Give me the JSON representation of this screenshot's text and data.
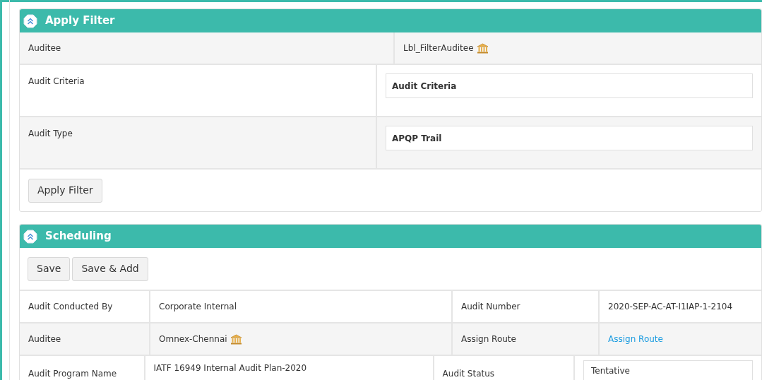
{
  "filter_panel": {
    "title": "Apply Filter",
    "rows": [
      {
        "label": "Auditee",
        "kind": "text_icon",
        "value": "Lbl_FilterAuditee"
      },
      {
        "label": "Audit Criteria",
        "kind": "field",
        "value": "Audit Criteria"
      },
      {
        "label": "Audit Type",
        "kind": "field",
        "value": "APQP Trail"
      }
    ],
    "button": "Apply Filter"
  },
  "scheduling_panel": {
    "title": "Scheduling",
    "buttons": [
      "Save",
      "Save & Add"
    ],
    "rows": [
      {
        "cells": [
          {
            "kind": "label",
            "text": "Audit Conducted By"
          },
          {
            "kind": "text",
            "text": "Corporate Internal"
          },
          {
            "kind": "label",
            "text": "Audit Number"
          },
          {
            "kind": "text",
            "text": "2020-SEP-AC-AT-I1IAP-1-2104"
          }
        ]
      },
      {
        "cells": [
          {
            "kind": "label",
            "text": "Auditee"
          },
          {
            "kind": "text_icon",
            "text": "Omnex-Chennai"
          },
          {
            "kind": "label",
            "text": "Assign Route"
          },
          {
            "kind": "link",
            "text": "Assign Route"
          }
        ]
      },
      {
        "cells": [
          {
            "kind": "label",
            "text": "Audit Program Name"
          },
          {
            "kind": "text_top",
            "text": "IATF 16949 Internal Audit Plan-2020"
          },
          {
            "kind": "label",
            "text": "Audit Status"
          },
          {
            "kind": "field",
            "text": "Tentative"
          }
        ]
      }
    ]
  }
}
